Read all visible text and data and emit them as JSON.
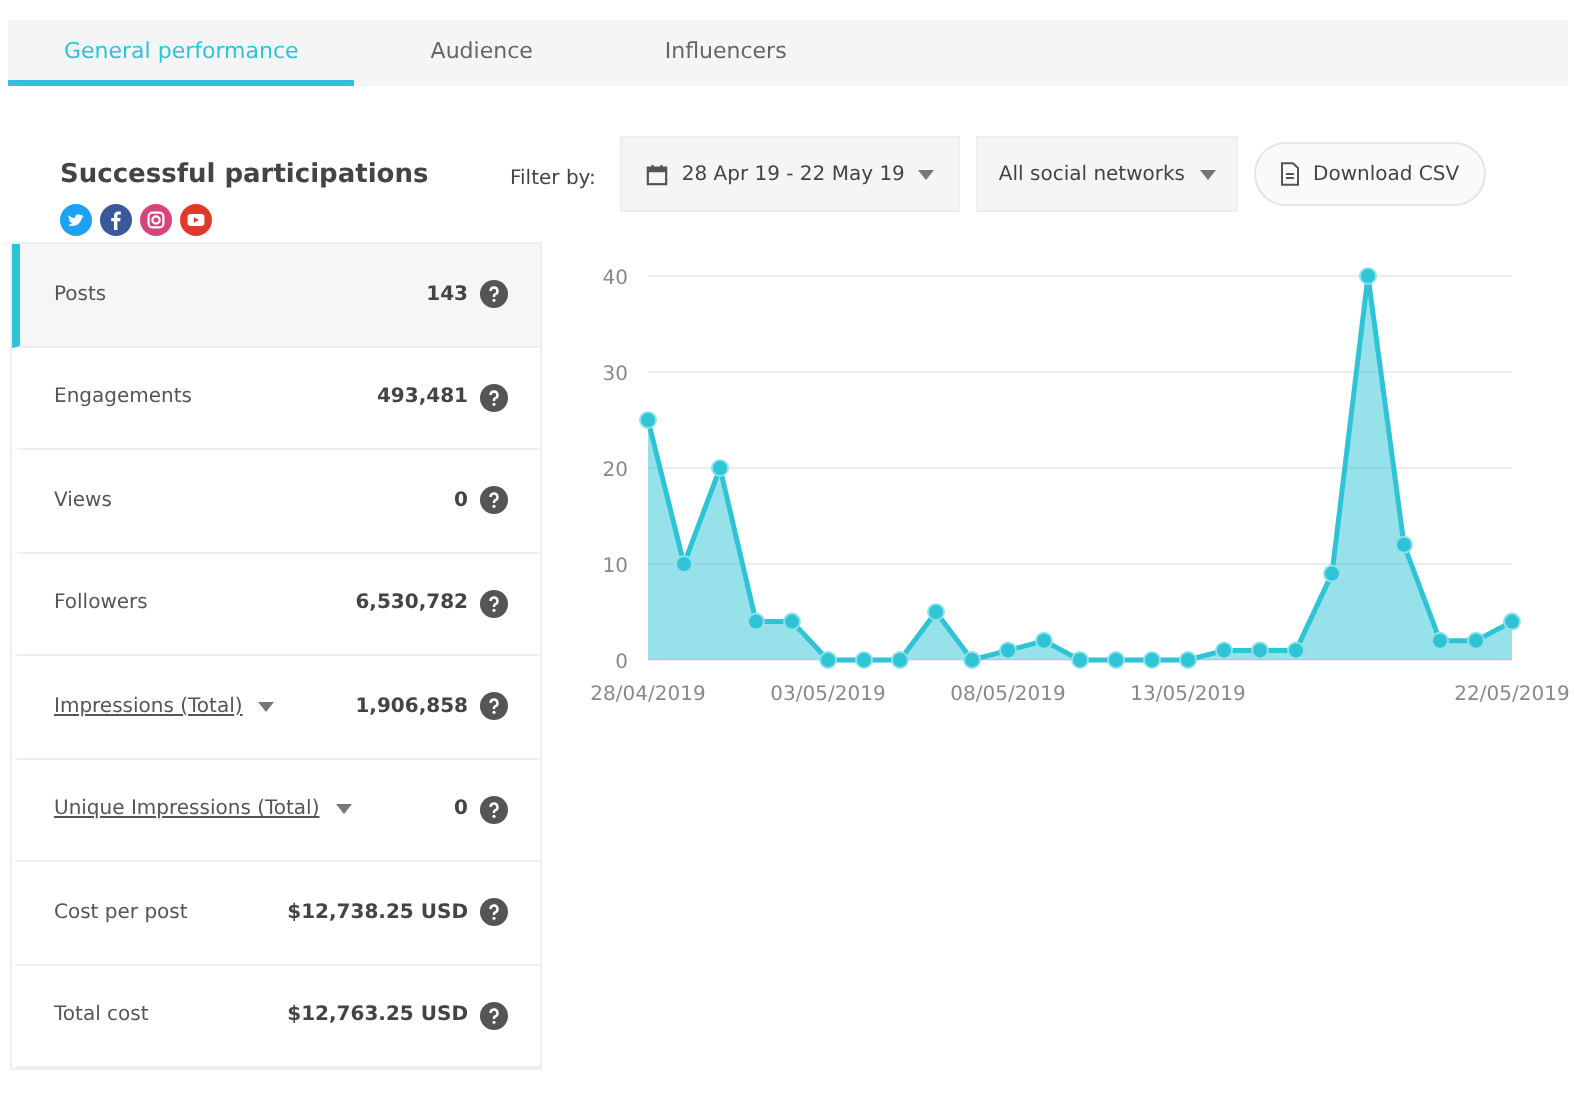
{
  "tabs": [
    {
      "label": "General performance",
      "selected": true
    },
    {
      "label": "Audience",
      "selected": false
    },
    {
      "label": "Influencers",
      "selected": false
    }
  ],
  "title": "Successful participations",
  "filter": {
    "label": "Filter by:",
    "date_range": "28 Apr 19 - 22 May 19",
    "network": "All social networks",
    "download": "Download CSV"
  },
  "stats": [
    {
      "label": "Posts",
      "value": "143",
      "kind": "plain",
      "selected": true
    },
    {
      "label": "Engagements",
      "value": "493,481",
      "kind": "plain",
      "selected": false
    },
    {
      "label": "Views",
      "value": "0",
      "kind": "plain",
      "selected": false
    },
    {
      "label": "Followers",
      "value": "6,530,782",
      "kind": "plain",
      "selected": false
    },
    {
      "label": "Impressions (Total)",
      "value": "1,906,858",
      "kind": "dropdown",
      "selected": false
    },
    {
      "label": "Unique Impressions (Total)",
      "value": "0",
      "kind": "dropdown",
      "selected": false
    },
    {
      "label": "Cost per post",
      "value": "$12,738.25 USD",
      "kind": "plain",
      "selected": false
    },
    {
      "label": "Total cost",
      "value": "$12,763.25 USD",
      "kind": "plain",
      "selected": false
    }
  ],
  "chart_data": {
    "type": "area",
    "categories": [
      "28/04/2019",
      null,
      null,
      null,
      null,
      "03/05/2019",
      null,
      null,
      null,
      null,
      "08/05/2019",
      null,
      null,
      null,
      null,
      "13/05/2019",
      null,
      null,
      null,
      null,
      null,
      null,
      null,
      null,
      "22/05/2019"
    ],
    "series": [
      {
        "color": "#2ec4d6",
        "values": [
          25,
          10,
          20,
          4,
          4,
          0,
          0,
          0,
          5,
          0,
          1,
          2,
          0,
          0,
          0,
          0,
          1,
          1,
          1,
          9,
          40,
          12,
          2,
          2,
          4
        ]
      }
    ],
    "ylim": [
      0,
      40
    ],
    "yticks": [
      0,
      10,
      20,
      30,
      40
    ],
    "grid": true
  }
}
